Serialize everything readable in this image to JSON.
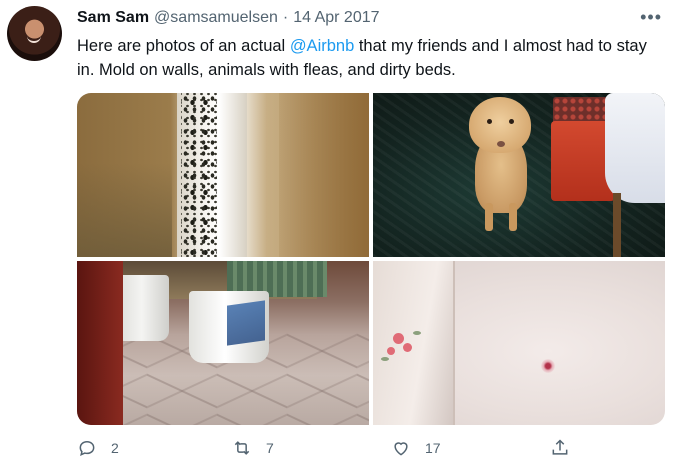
{
  "tweet": {
    "author_name": "Sam Sam",
    "handle": "@samsamuelsen",
    "separator": "·",
    "date": "14 Apr 2017",
    "more_label": "•••",
    "text_before": "Here are photos of an actual ",
    "mention": "@Airbnb",
    "text_after": " that my friends and I almost had to stay in. Mold on walls, animals with fleas, and dirty beds."
  },
  "media": {
    "photos": [
      "mold-wall",
      "dog",
      "bucket-floor",
      "stained-bed"
    ]
  },
  "actions": {
    "replies": "2",
    "retweets": "7",
    "likes": "17"
  },
  "icons": {
    "reply": "reply-icon",
    "retweet": "retweet-icon",
    "like": "heart-icon",
    "share": "share-icon"
  },
  "colors": {
    "mention": "#1d9bf0",
    "secondary_text": "#536471"
  }
}
